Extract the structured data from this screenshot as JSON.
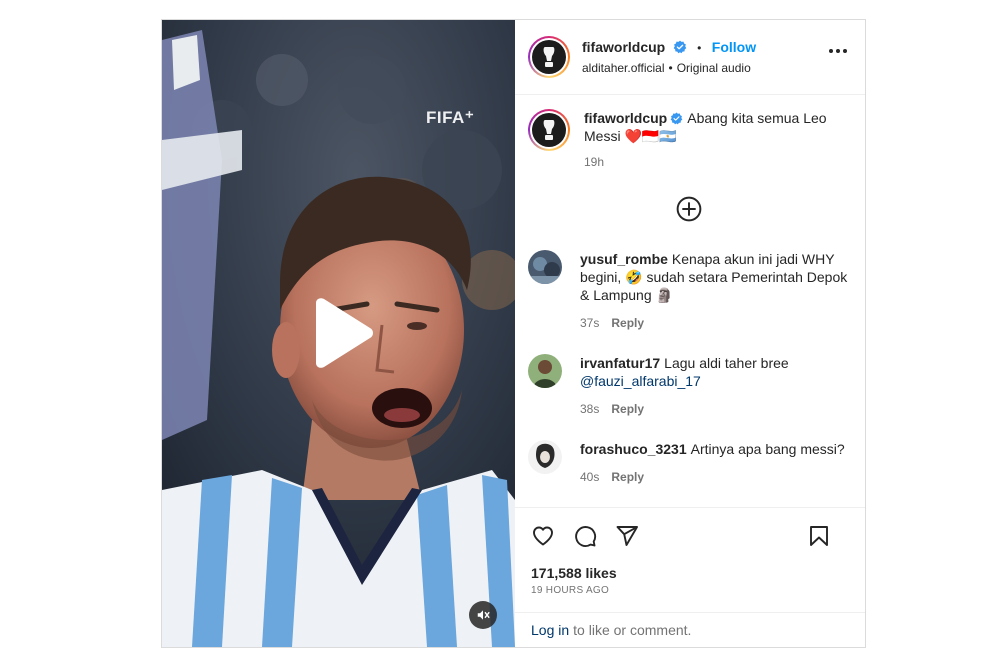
{
  "header": {
    "username": "fifaworldcup",
    "follow_label": "Follow",
    "subline_author": "alditaher.official",
    "subline_audio": "Original audio"
  },
  "video": {
    "watermark": "FIFA⁺"
  },
  "caption": {
    "username": "fifaworldcup",
    "text": "Abang kita semua Leo Messi ❤️🇮🇩🇦🇷",
    "time": "19h"
  },
  "comments": [
    {
      "username": "yusuf_rombe",
      "text": "Kenapa akun ini jadi WHY begini, 🤣 sudah setara Pemerintah Depok & Lampung 🗿",
      "time": "37s",
      "reply_label": "Reply"
    },
    {
      "username": "irvanfatur17",
      "text": "Lagu aldi taher bree",
      "mention": "@fauzi_alfarabi_17",
      "time": "38s",
      "reply_label": "Reply"
    },
    {
      "username": "forashuco_3231",
      "text": "Artinya apa bang messi?",
      "time": "40s",
      "reply_label": "Reply"
    }
  ],
  "stats": {
    "likes": "171,588 likes",
    "posted_ago": "19 HOURS AGO"
  },
  "footer": {
    "login_link": "Log in",
    "login_suffix": "to like or comment."
  },
  "icons": {
    "verified": "verified-badge-icon",
    "more": "more-options-icon",
    "load_more": "circle-plus-icon",
    "like": "heart-icon",
    "comment": "comment-bubble-icon",
    "share": "paper-plane-icon",
    "save": "bookmark-icon",
    "play": "play-icon",
    "mute": "speaker-muted-icon"
  },
  "colors": {
    "follow_blue": "#0095f6",
    "link_dark_blue": "#00376b",
    "verified_blue": "#3897f0",
    "muted_text": "#737373"
  }
}
